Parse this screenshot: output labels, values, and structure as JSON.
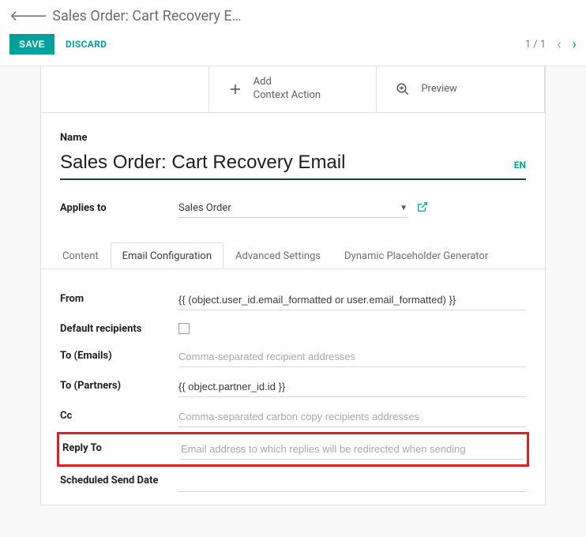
{
  "breadcrumb": {
    "title": "Sales Order: Cart Recovery E…"
  },
  "actions": {
    "save": "SAVE",
    "discard": "DISCARD",
    "pager": "1 / 1"
  },
  "top_actions": {
    "add_line1": "Add",
    "add_line2": "Context Action",
    "preview": "Preview"
  },
  "form": {
    "name_label": "Name",
    "name_value": "Sales Order: Cart Recovery Email",
    "lang": "EN",
    "applies_label": "Applies to",
    "applies_value": "Sales Order"
  },
  "tabs": {
    "content": "Content",
    "email_config": "Email Configuration",
    "advanced": "Advanced Settings",
    "dynamic": "Dynamic Placeholder Generator"
  },
  "fields": {
    "from_label": "From",
    "from_value": "{{ (object.user_id.email_formatted or user.email_formatted) }}",
    "default_recipients_label": "Default recipients",
    "to_emails_label": "To (Emails)",
    "to_emails_placeholder": "Comma-separated recipient addresses",
    "to_partners_label": "To (Partners)",
    "to_partners_value": "{{ object.partner_id.id }}",
    "cc_label": "Cc",
    "cc_placeholder": "Comma-separated carbon copy recipients addresses",
    "reply_to_label": "Reply To",
    "reply_to_placeholder": "Email address to which replies will be redirected when sending",
    "scheduled_label": "Scheduled Send Date"
  }
}
